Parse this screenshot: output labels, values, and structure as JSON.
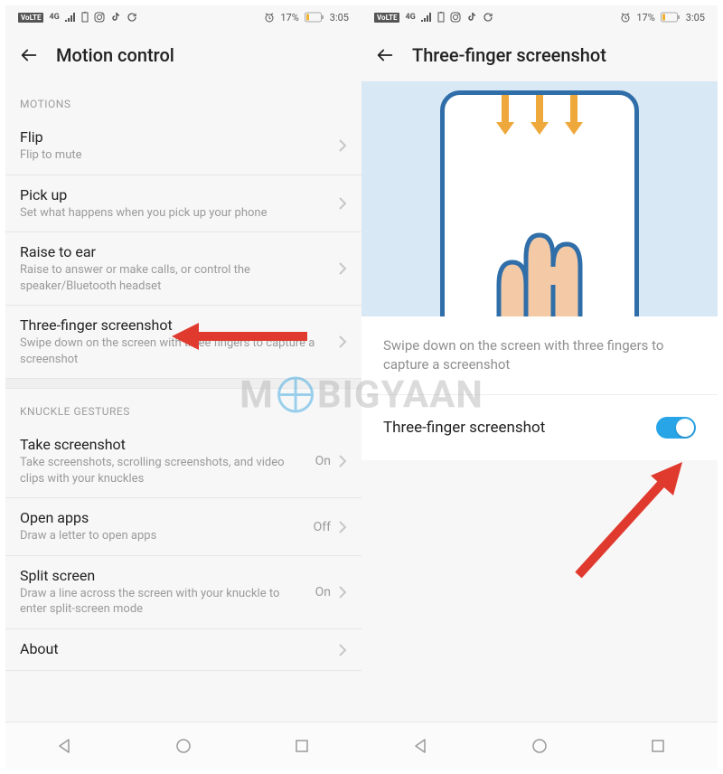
{
  "status": {
    "volte": "VoLTE",
    "net": "4G",
    "battery_pct": "17%",
    "time": "3:05"
  },
  "screen1": {
    "title": "Motion control",
    "section_motions": "MOTIONS",
    "section_knuckle": "KNUCKLE GESTURES",
    "rows": {
      "flip": {
        "title": "Flip",
        "sub": "Flip to mute"
      },
      "pickup": {
        "title": "Pick up",
        "sub": "Set what happens when you pick up your phone"
      },
      "raise": {
        "title": "Raise to ear",
        "sub": "Raise to answer or make calls, or control the speaker/Bluetooth headset"
      },
      "three": {
        "title": "Three-finger screenshot",
        "sub": "Swipe down on the screen with three fingers to capture a screenshot"
      },
      "takeshot": {
        "title": "Take screenshot",
        "sub": "Take screenshots, scrolling screenshots, and video clips with your knuckles",
        "value": "On"
      },
      "openapps": {
        "title": "Open apps",
        "sub": "Draw a letter to open apps",
        "value": "Off"
      },
      "split": {
        "title": "Split screen",
        "sub": "Draw a line across the screen with your knuckle to enter split-screen mode",
        "value": "On"
      },
      "about": {
        "title": "About"
      }
    }
  },
  "screen2": {
    "title": "Three-finger screenshot",
    "desc": "Swipe down on the screen with three fingers to capture a screenshot",
    "toggle_label": "Three-finger screenshot",
    "toggle_on": true
  },
  "watermark": {
    "m": "M",
    "rest": "BIGYAAN"
  }
}
